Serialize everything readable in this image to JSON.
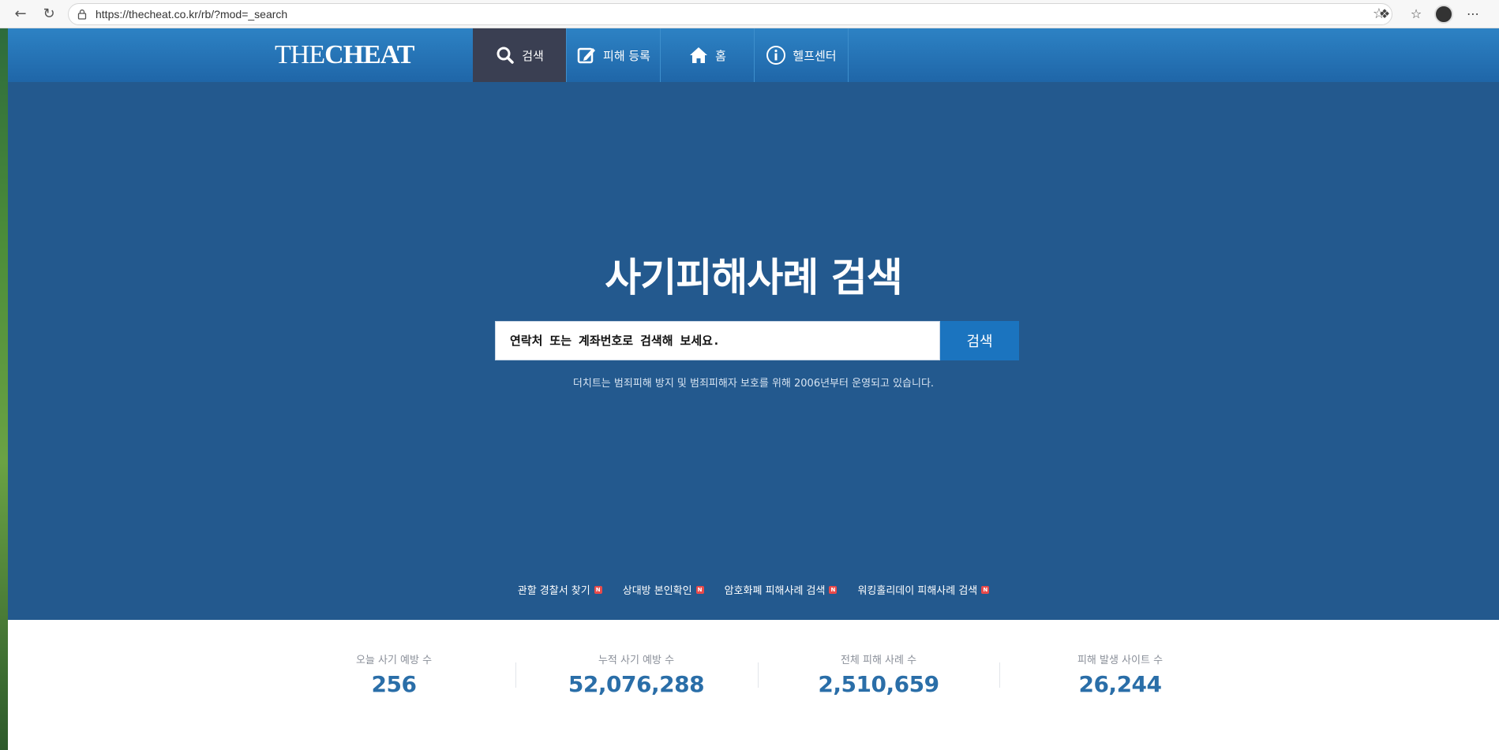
{
  "browser": {
    "url": "https://thecheat.co.kr/rb/?mod=_search",
    "icons": [
      "back-icon",
      "refresh-icon",
      "lock-icon",
      "star-icon",
      "extensions-icon",
      "favorites-icon",
      "profile-avatar",
      "more-icon"
    ]
  },
  "header": {
    "logo_light": "THE",
    "logo_bold": "CHEAT",
    "nav": [
      {
        "label": "검색",
        "icon": "search-icon"
      },
      {
        "label": "피해 등록",
        "icon": "edit-icon"
      },
      {
        "label": "홈",
        "icon": "home-icon"
      },
      {
        "label": "헬프센터",
        "icon": "info-icon"
      }
    ]
  },
  "hero": {
    "title": "사기피해사례 검색",
    "search_placeholder": "연락처 또는 계좌번호로 검색해 보세요.",
    "search_button": "검색",
    "subtitle": "더치트는 범죄피해 방지 및 범죄피해자 보호를 위해 2006년부터 운영되고 있습니다.",
    "quick_links": [
      {
        "label": "관할 경찰서 찾기",
        "badge": "N"
      },
      {
        "label": "상대방 본인확인",
        "badge": "N"
      },
      {
        "label": "암호화폐 피해사례 검색",
        "badge": "N"
      },
      {
        "label": "워킹홀리데이 피해사례 검색",
        "badge": "N"
      }
    ]
  },
  "stats": [
    {
      "label": "오늘 사기 예방 수",
      "value": "256"
    },
    {
      "label": "누적 사기 예방 수",
      "value": "52,076,288"
    },
    {
      "label": "전체 피해 사례 수",
      "value": "2,510,659"
    },
    {
      "label": "피해 발생 사이트 수",
      "value": "26,244"
    }
  ],
  "colors": {
    "header": "#2d82c4",
    "hero": "#23598e",
    "nav_active": "#3a3f52",
    "search_button": "#1b74bf",
    "stat_value": "#2a6ea8"
  }
}
